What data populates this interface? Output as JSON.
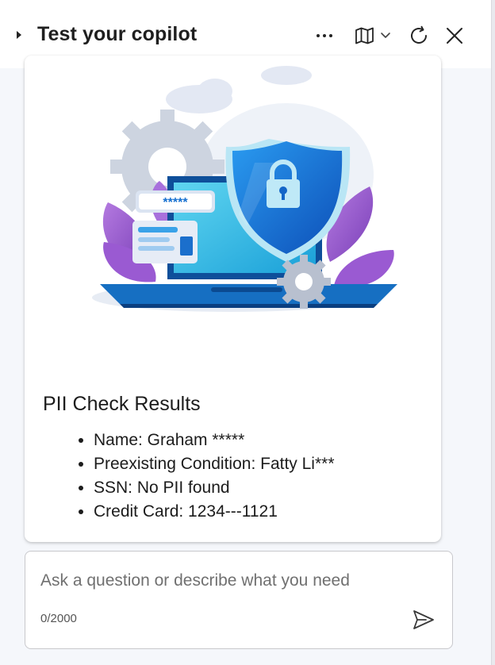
{
  "header": {
    "title": "Test your copilot",
    "icons": [
      "caret-right-icon",
      "more-icon",
      "map-icon",
      "chevron-down-icon",
      "refresh-icon",
      "close-icon"
    ]
  },
  "card": {
    "illustration": "security-shield-laptop-illustration",
    "password_mask": "*****",
    "heading": "PII Check Results",
    "items": [
      "Name: Graham *****",
      "Preexisting Condition: Fatty Li***",
      "SSN: No PII found",
      "Credit Card: 1234---1121"
    ]
  },
  "composer": {
    "placeholder": "Ask a question or describe what you need",
    "value": "",
    "char_count": "0/2000"
  },
  "colors": {
    "shield": "#1679e0",
    "laptop": "#20b7e6",
    "leaves": "#8f4fc7",
    "gear": "#c5ccd8"
  }
}
